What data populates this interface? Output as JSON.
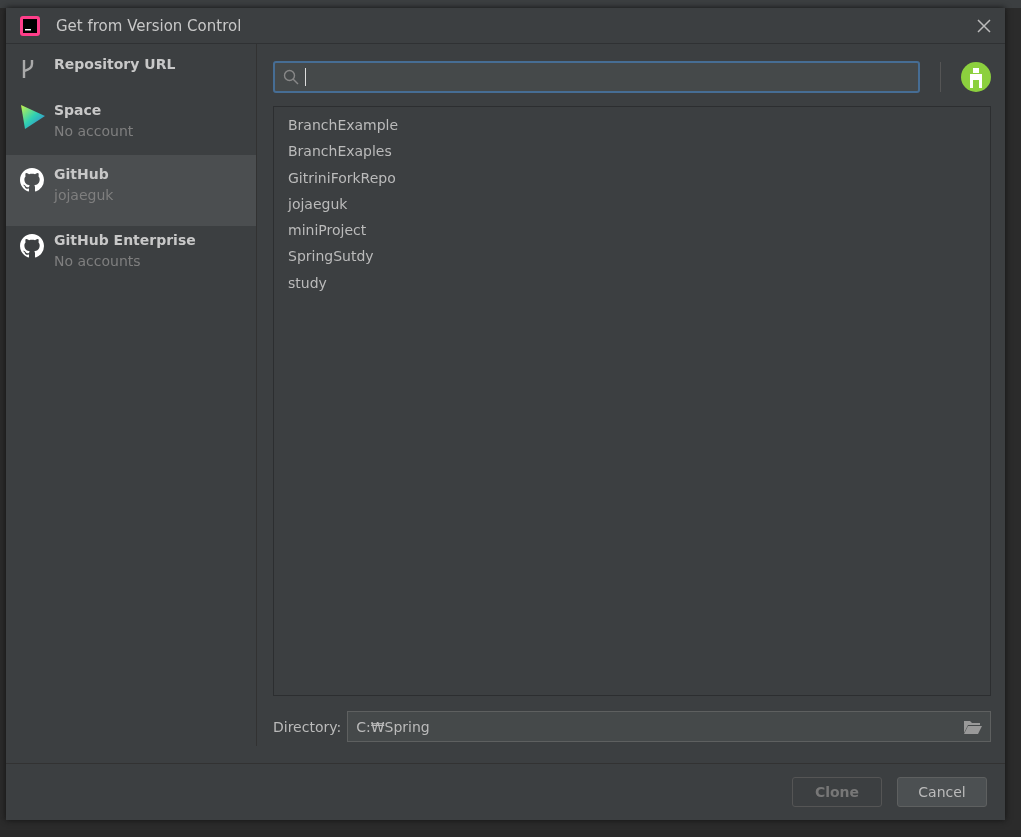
{
  "window": {
    "title": "Get from Version Control"
  },
  "sidebar": {
    "items": [
      {
        "kind": "branch",
        "label": "Repository URL",
        "selected": false
      },
      {
        "kind": "space",
        "label": "Space",
        "subtitle": "No account",
        "selected": false
      },
      {
        "kind": "github",
        "label": "GitHub",
        "subtitle": "jojaeguk",
        "selected": true
      },
      {
        "kind": "github",
        "label": "GitHub Enterprise",
        "subtitle": "No accounts",
        "selected": false
      }
    ]
  },
  "search": {
    "focused": true
  },
  "repositories": [
    {
      "name": "BranchExample"
    },
    {
      "name": "BranchExaples"
    },
    {
      "name": "GitriniForkRepo"
    },
    {
      "name": "jojaeguk"
    },
    {
      "name": "miniProject"
    },
    {
      "name": "SpringSutdy"
    },
    {
      "name": "study"
    }
  ],
  "directory": {
    "label": "Directory:",
    "value": "C:₩Spring"
  },
  "buttons": [
    {
      "label": "Clone",
      "disabled": true
    },
    {
      "label": "Cancel",
      "disabled": false
    }
  ]
}
